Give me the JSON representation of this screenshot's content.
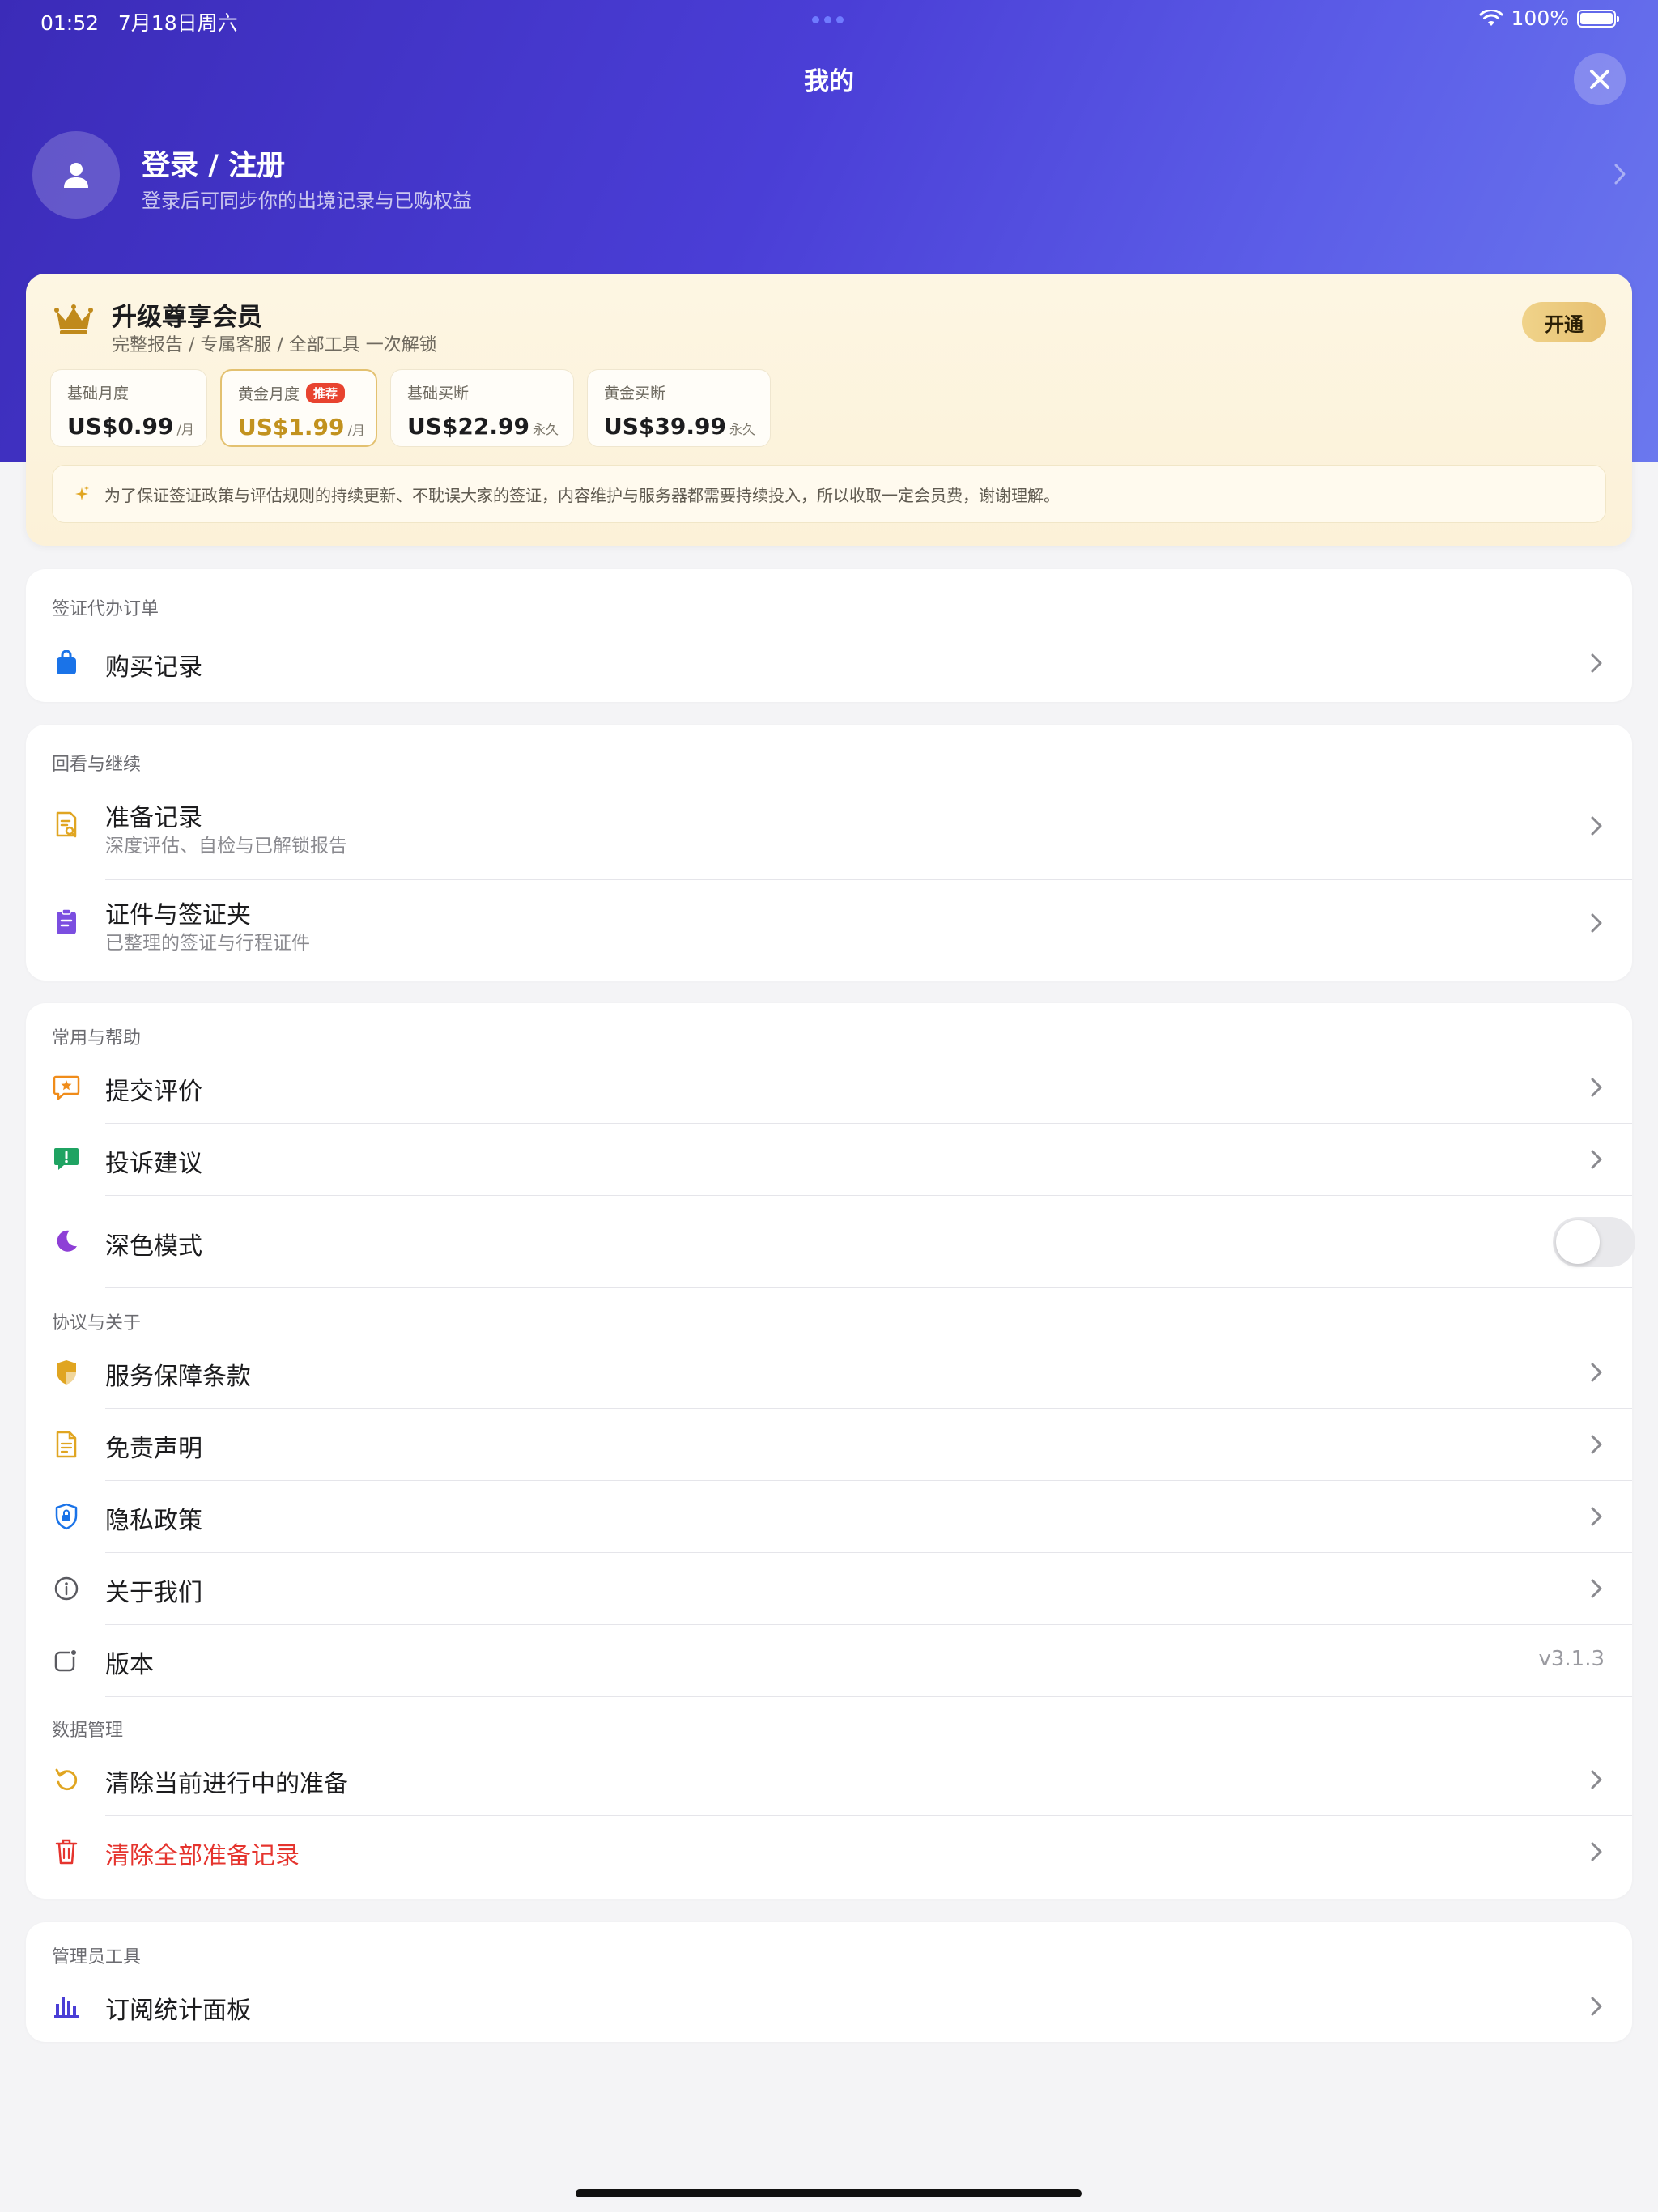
{
  "status_bar": {
    "time": "01:52",
    "date": "7月18日周六",
    "battery": "100%"
  },
  "header": {
    "title": "我的"
  },
  "profile": {
    "name": "登录 / 注册",
    "subtitle": "登录后可同步你的出境记录与已购权益"
  },
  "membership": {
    "title": "升级尊享会员",
    "subtitle": "完整报告 / 专属客服 / 全部工具 一次解锁",
    "open_label": "开通",
    "plans": [
      {
        "name": "基础月度",
        "price": "US$0.99",
        "unit": "/月",
        "badge": ""
      },
      {
        "name": "黄金月度",
        "price": "US$1.99",
        "unit": "/月",
        "badge": "推荐"
      },
      {
        "name": "基础买断",
        "price": "US$22.99",
        "unit": "永久",
        "badge": ""
      },
      {
        "name": "黄金买断",
        "price": "US$39.99",
        "unit": "永久",
        "badge": ""
      }
    ],
    "notice": "为了保证签证政策与评估规则的持续更新、不耽误大家的签证，内容维护与服务器都需要持续投入，所以收取一定会员费，谢谢理解。"
  },
  "sections": {
    "visa_orders": {
      "label": "签证代办订单",
      "items": [
        {
          "title": "购买记录"
        }
      ]
    },
    "review": {
      "label": "回看与继续",
      "items": [
        {
          "title": "准备记录",
          "subtitle": "深度评估、自检与已解锁报告"
        },
        {
          "title": "证件与签证夹",
          "subtitle": "已整理的签证与行程证件"
        }
      ]
    },
    "common": {
      "label": "常用与帮助",
      "items": [
        {
          "title": "提交评价"
        },
        {
          "title": "投诉建议"
        },
        {
          "title": "深色模式",
          "toggle": false
        }
      ]
    },
    "about": {
      "label": "协议与关于",
      "items": [
        {
          "title": "服务保障条款"
        },
        {
          "title": "免责声明"
        },
        {
          "title": "隐私政策"
        },
        {
          "title": "关于我们"
        },
        {
          "title": "版本",
          "value": "v3.1.3"
        }
      ]
    },
    "data": {
      "label": "数据管理",
      "items": [
        {
          "title": "清除当前进行中的准备"
        },
        {
          "title": "清除全部准备记录"
        }
      ]
    },
    "admin": {
      "label": "管理员工具",
      "items": [
        {
          "title": "订阅统计面板"
        }
      ]
    }
  },
  "colors": {
    "accent": "#4a3ed6",
    "gold": "#c2921e",
    "danger": "#e5342e"
  }
}
